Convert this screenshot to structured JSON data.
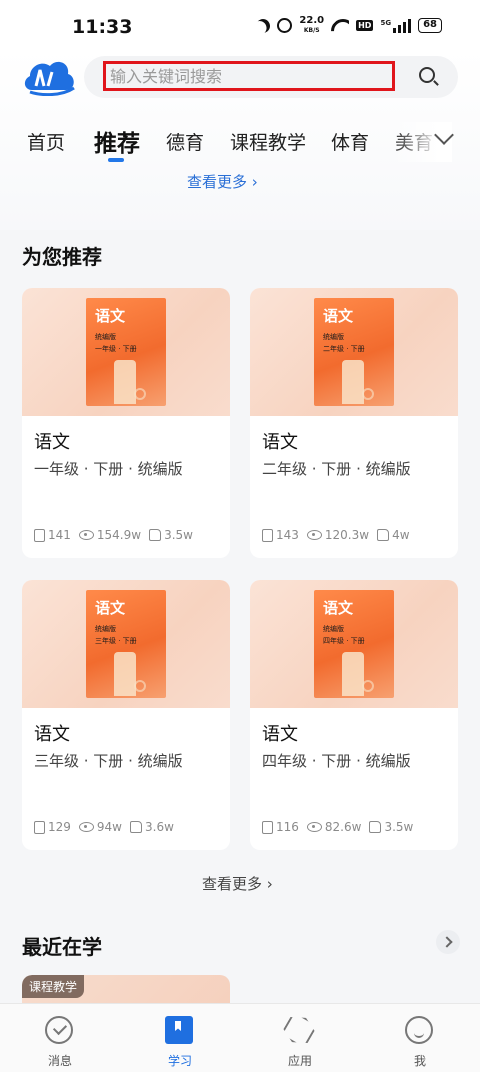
{
  "status_bar": {
    "time": "11:33",
    "speed_value": "22.0",
    "speed_unit": "KB/S",
    "hd_badge": "HD",
    "network": "5G",
    "battery": "68"
  },
  "search": {
    "placeholder": "输入关键词搜索"
  },
  "tabs": [
    "首页",
    "推荐",
    "德育",
    "课程教学",
    "体育",
    "美育"
  ],
  "active_tab": "推荐",
  "see_more_top": "查看更多 ›",
  "recommend": {
    "title": "为您推荐",
    "cards": [
      {
        "cover_title": "语文",
        "cover_edition": "统编版",
        "cover_grade": "一年级 · 下册",
        "name": "语文",
        "subtitle": "一年级 · 下册 · 统编版",
        "lessons": "141",
        "views": "154.9w",
        "likes": "3.5w"
      },
      {
        "cover_title": "语文",
        "cover_edition": "统编版",
        "cover_grade": "二年级 · 下册",
        "name": "语文",
        "subtitle": "二年级 · 下册 · 统编版",
        "lessons": "143",
        "views": "120.3w",
        "likes": "4w"
      },
      {
        "cover_title": "语文",
        "cover_edition": "统编版",
        "cover_grade": "三年级 · 下册",
        "name": "语文",
        "subtitle": "三年级 · 下册 · 统编版",
        "lessons": "129",
        "views": "94w",
        "likes": "3.6w"
      },
      {
        "cover_title": "语文",
        "cover_edition": "统编版",
        "cover_grade": "四年级 · 下册",
        "name": "语文",
        "subtitle": "四年级 · 下册 · 统编版",
        "lessons": "116",
        "views": "82.6w",
        "likes": "3.5w"
      }
    ],
    "see_more": "查看更多 ›"
  },
  "recent": {
    "title": "最近在学",
    "tag": "课程教学"
  },
  "bottom_nav": [
    {
      "label": "消息",
      "icon": "message-icon"
    },
    {
      "label": "学习",
      "icon": "study-icon"
    },
    {
      "label": "应用",
      "icon": "apps-icon"
    },
    {
      "label": "我",
      "icon": "profile-icon"
    }
  ],
  "colors": {
    "accent": "#1f6fe0",
    "search_highlight": "#e0151b",
    "cover_orange": "#f26b2e"
  }
}
